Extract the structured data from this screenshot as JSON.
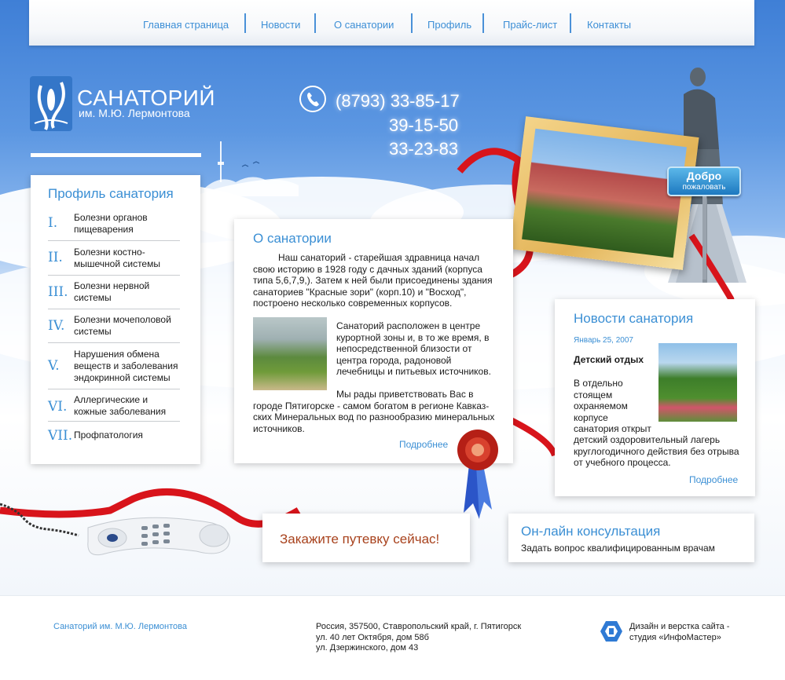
{
  "nav": {
    "items": [
      "Главная страница",
      "Новости",
      "О санатории",
      "Профиль",
      "Прайс-лист",
      "Контакты"
    ]
  },
  "logo": {
    "title": "САНАТОРИЙ",
    "subtitle": "им. М.Ю. Лермонтова"
  },
  "phones": [
    "(8793) 33-85-17",
    "39-15-50",
    "33-23-83"
  ],
  "welcome_sign": {
    "line1": "Добро",
    "line2": "пожаловать"
  },
  "profile": {
    "title": "Профиль санатория",
    "items": [
      {
        "num": "I.",
        "label": "Болезни органов пищеварения"
      },
      {
        "num": "II.",
        "label": "Болезни костно-мышечной системы"
      },
      {
        "num": "III.",
        "label": "Болезни нервной системы"
      },
      {
        "num": "IV.",
        "label": "Болезни мочеполовой системы"
      },
      {
        "num": "V.",
        "label": "Нарушения обмена веществ и заболевания эндокринной системы"
      },
      {
        "num": "VI.",
        "label": "Аллергические и кожные заболевания"
      },
      {
        "num": "VII.",
        "label": "Профпатология"
      }
    ]
  },
  "about": {
    "title": "О санатории",
    "p1": "Наш санаторий - старейшая здравница начал свою историю в 1928 году с дачных зданий (корпуса типа 5,6,7,9,). Затем к ней были присоединены здания санаториев \"Красные зори\" (корп.10) и \"Восход\", построено несколько современных корпусов.",
    "p2": "Санаторий расположен в центре курортной зоны и, в то же время, в непосредственной близости от центра города, радоновой лечебницы и питьевых источников.",
    "p3": "Мы рады приветствовать Вас в городе Пятигорске - самом богатом в регионе Кавказ-ских Минеральных вод по разнообразию  минеральных источников.",
    "more": "Подробнее"
  },
  "news": {
    "title": "Новости санатория",
    "date": "Январь 25, 2007",
    "headline": "Детский отдых",
    "text_short": "В отдельно стоящем охраняемом корпусе санатория открыт",
    "text_rest": "детский оздоровительный лагерь круглогодичного действия без отрыва от учебного процесса.",
    "more": "Подробнее"
  },
  "order": {
    "label": "Закажите путевку сейчас!"
  },
  "consult": {
    "title": "Он-лайн консультация",
    "subtitle": "Задать вопрос квалифицированным врачам"
  },
  "footer": {
    "name": "Санаторий им. М.Ю. Лермонтова",
    "address": [
      "Россия, 357500, Ставропольский край, г. Пятигорск",
      "ул. 40 лет Октября, дом 58б",
      "ул. Дзержинского, дом 43"
    ],
    "credits": [
      "Дизайн и верстка сайта -",
      "студия «ИнфоМастер»"
    ]
  },
  "colors": {
    "accent": "#3b8fd4",
    "sky": "#3f7fd6",
    "ribbon": "#d8141b",
    "order_text": "#a8421d"
  },
  "icons": [
    "logo-mark-icon",
    "phone-icon",
    "telephone-handset-icon",
    "wax-seal-icon",
    "infomaster-logo-icon"
  ]
}
